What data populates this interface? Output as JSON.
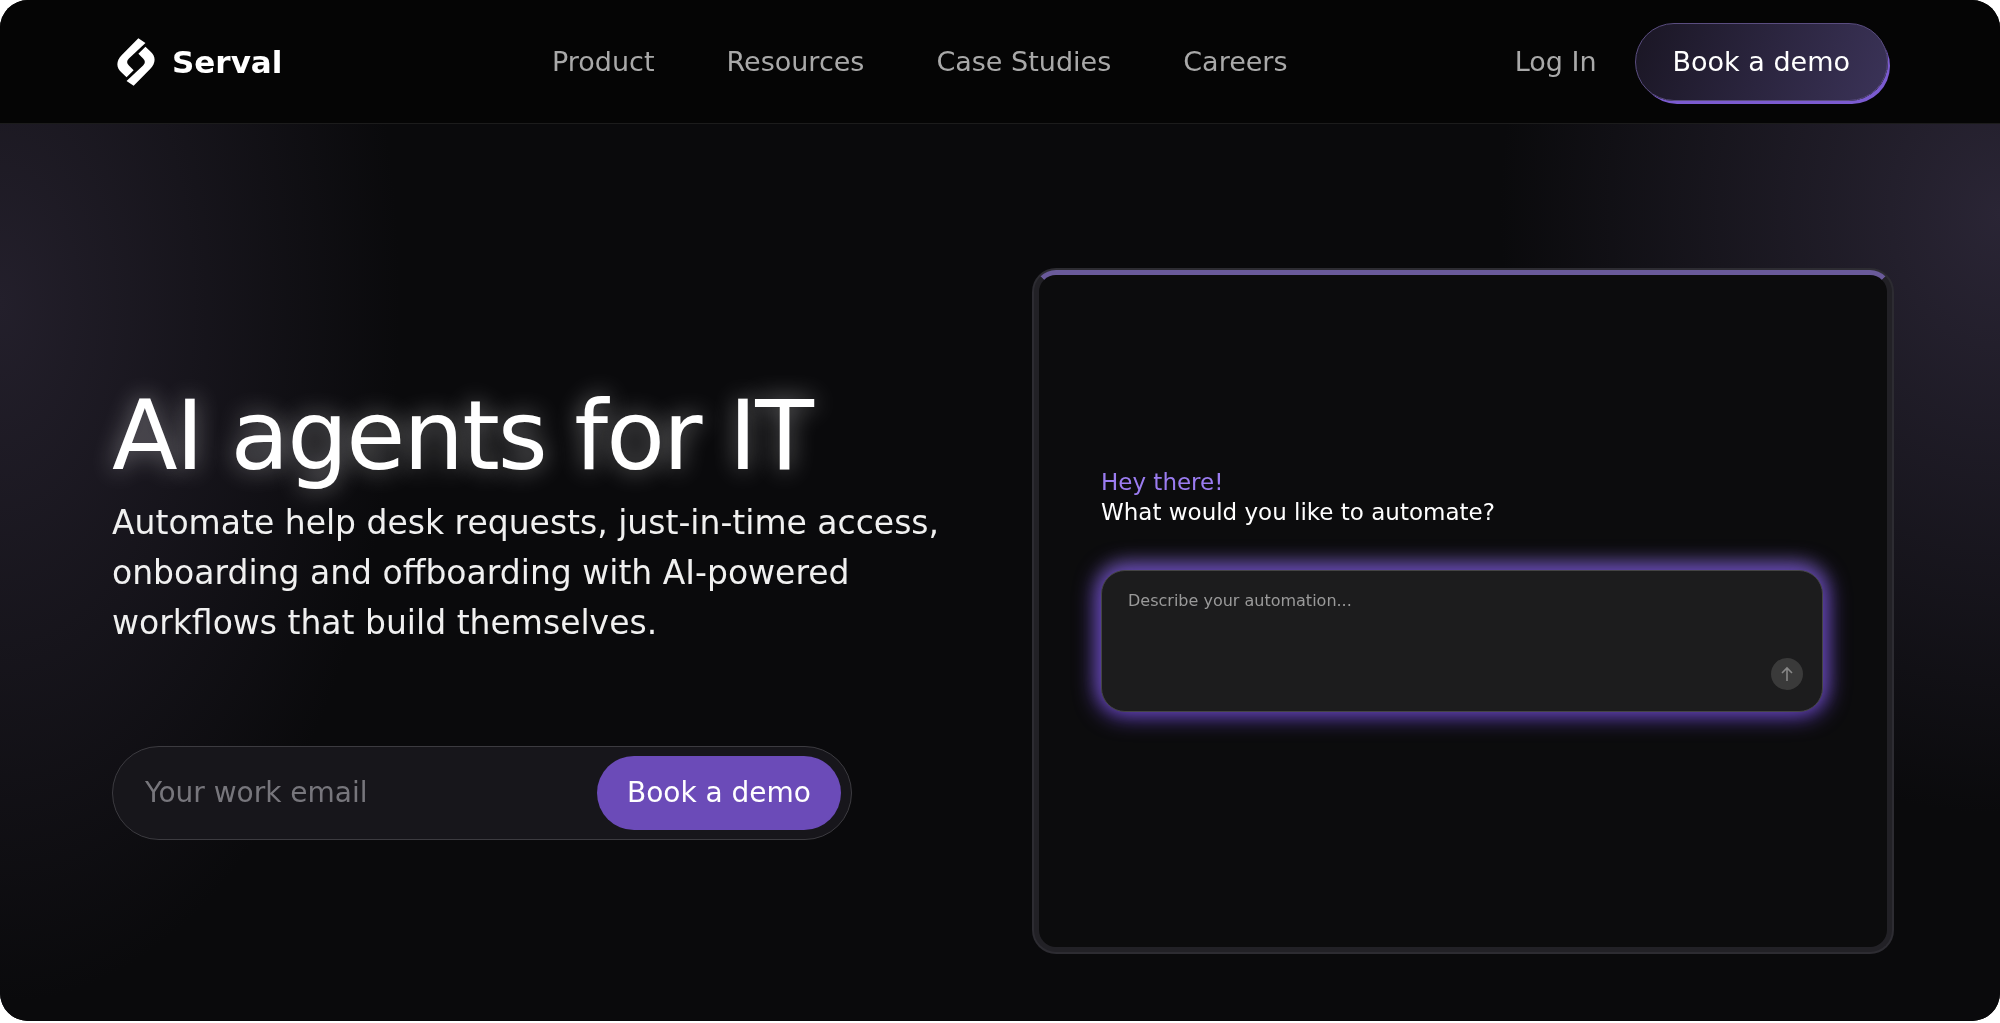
{
  "header": {
    "logo": "Serval",
    "nav": [
      "Product",
      "Resources",
      "Case Studies",
      "Careers"
    ],
    "login": "Log In",
    "cta": "Book a demo"
  },
  "hero": {
    "title": "AI agents for IT",
    "subtitle": "Automate help desk requests, just-in-time access, onboarding and offboarding with AI-powered workflows that build themselves.",
    "email": {
      "placeholder": "Your work email"
    },
    "button": "Book a demo"
  },
  "chat": {
    "greeting": "Hey there!",
    "question": "What would you like to automate?",
    "input": {
      "placeholder": "Describe your automation..."
    }
  }
}
